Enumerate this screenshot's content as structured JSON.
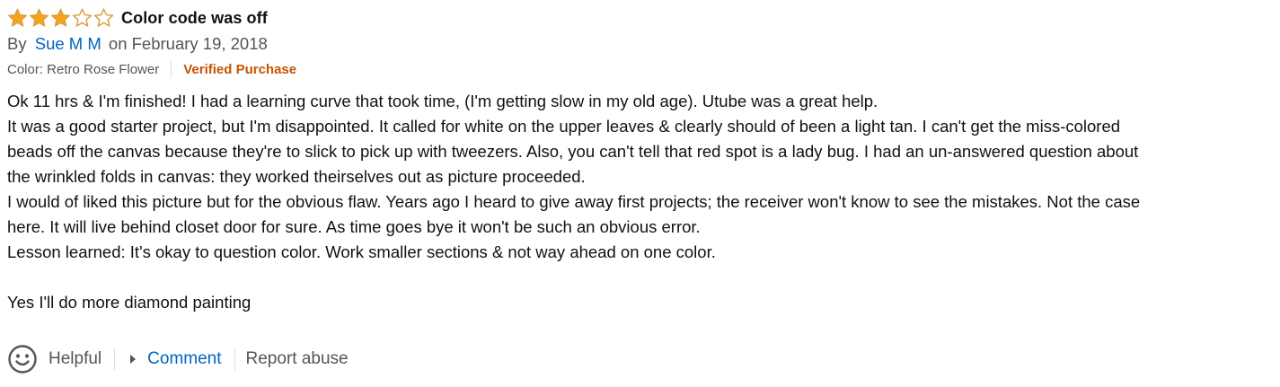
{
  "review": {
    "rating": 3,
    "rating_max": 5,
    "star_color": "#f4a419",
    "star_outline_color": "#d89c3c",
    "title": "Color code was off",
    "byline_prefix": "By",
    "author": "Sue M M",
    "date": "on February 19, 2018",
    "color_variant": "Color: Retro Rose Flower",
    "verified": "Verified Purchase",
    "body": [
      "Ok 11 hrs & I'm finished! I had a learning curve that took time, (I'm getting slow in my old age). Utube was a great help.",
      "It was a good starter project, but I'm disappointed. It called for white on the upper leaves & clearly should of been a light tan. I can't get the miss-colored",
      "beads off the canvas because they're to slick to pick up with tweezers. Also, you can't tell that red spot is a lady bug. I had an un-answered question about",
      "the wrinkled folds in canvas: they worked theirselves out as picture proceeded.",
      "I would of liked this picture but for the obvious flaw. Years ago I heard to give away first projects; the receiver won't know to see the mistakes. Not the case",
      "here. It will live behind closet door for sure. As time goes bye it won't be such an obvious error.",
      "Lesson learned: It's okay to question color. Work smaller sections & not way ahead on one color.",
      "",
      "Yes I'll do more diamond painting"
    ]
  },
  "actions": {
    "helpful_icon": "smiley-icon",
    "helpful": "Helpful",
    "comment_icon": "caret-right-icon",
    "comment": "Comment",
    "report": "Report abuse"
  },
  "colors": {
    "link": "#0066c0",
    "verified": "#c45500",
    "secondary_text": "#555555"
  }
}
